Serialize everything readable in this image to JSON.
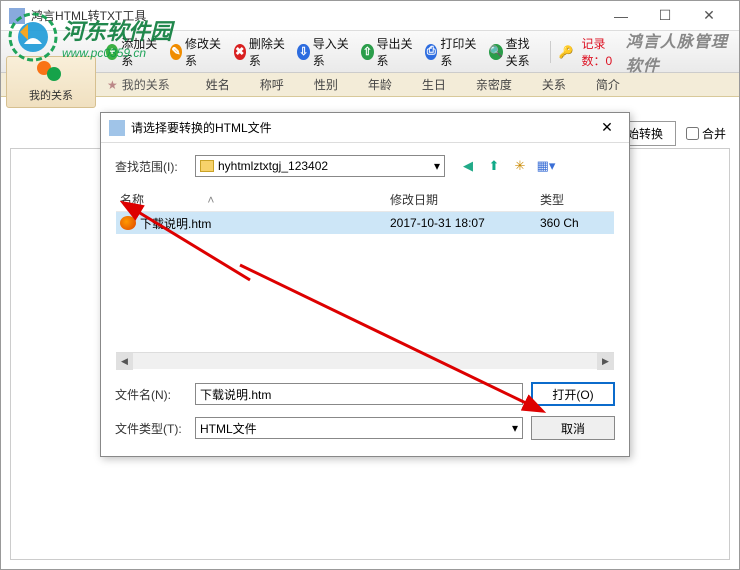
{
  "window": {
    "title": "鸿言HTML转TXT工具",
    "controls": {
      "min": "—",
      "max": "☐",
      "close": "✕"
    }
  },
  "watermark": {
    "title": "河东软件园",
    "url": "www.pc0359.cn"
  },
  "toolbar": {
    "buttons": [
      {
        "icon": "plus",
        "color": "ic-green",
        "label": "添加关系"
      },
      {
        "icon": "edit",
        "color": "ic-orange",
        "label": "修改关系"
      },
      {
        "icon": "del",
        "color": "ic-red",
        "label": "删除关系"
      },
      {
        "icon": "in",
        "color": "ic-blue",
        "label": "导入关系"
      },
      {
        "icon": "out",
        "color": "ic-g2",
        "label": "导出关系"
      },
      {
        "icon": "print",
        "color": "ic-blue",
        "label": "打印关系"
      },
      {
        "icon": "find",
        "color": "ic-g2",
        "label": "查找关系"
      }
    ],
    "record_label": "记录数：",
    "record_value": "0",
    "brand": "鸿言人脉管理软件"
  },
  "sidebar": {
    "label": "我的关系"
  },
  "subheader": {
    "tab": "我的关系",
    "columns": [
      "姓名",
      "称呼",
      "性别",
      "年龄",
      "生日",
      "亲密度",
      "关系",
      "简介"
    ]
  },
  "actions": {
    "start": "开始转换",
    "merge": "合并"
  },
  "dialog": {
    "title": "请选择要转换的HTML文件",
    "close": "✕",
    "lookin_label": "查找范围(I):",
    "lookin_value": "hyhtmlztxtgj_123402",
    "columns": {
      "name": "名称",
      "date": "修改日期",
      "type": "类型"
    },
    "files": [
      {
        "name": "下载说明.htm",
        "date": "2017-10-31 18:07",
        "type": "360 Ch"
      }
    ],
    "filename_label": "文件名(N):",
    "filename_value": "下载说明.htm",
    "filetype_label": "文件类型(T):",
    "filetype_value": "HTML文件",
    "open": "打开(O)",
    "cancel": "取消"
  }
}
